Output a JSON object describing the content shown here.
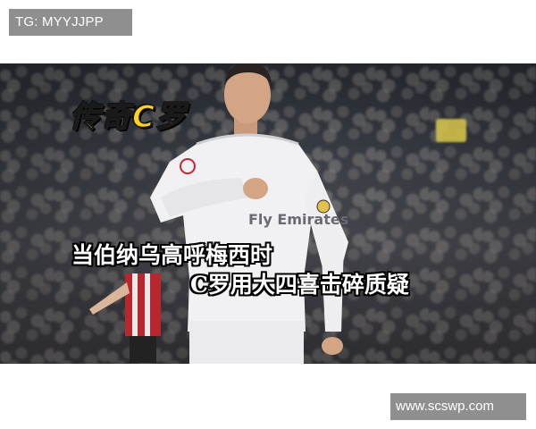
{
  "watermark_top": "TG: MYYJJPP",
  "photo": {
    "title_badge": "传奇C罗",
    "headline_line1": "当伯纳乌高呼梅西时",
    "headline_line2": "C罗用大四喜击碎质疑",
    "jersey_text": "Fly Emirates",
    "badge_color": "#ffd21f"
  },
  "watermark_bottom": "www.scswp.com"
}
